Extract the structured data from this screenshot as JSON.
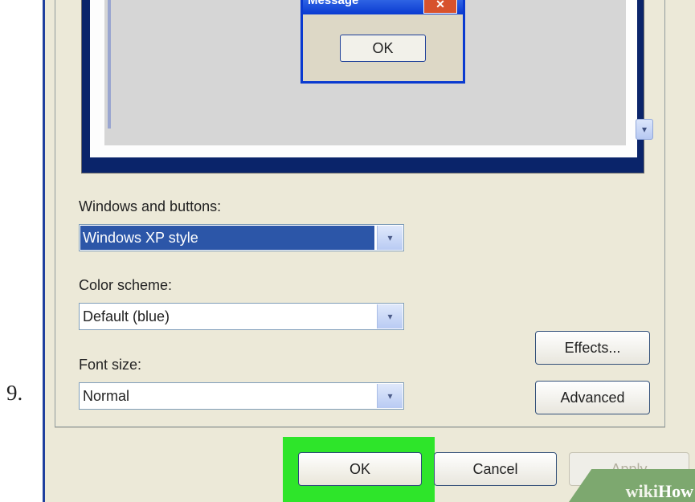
{
  "step": {
    "number": "9."
  },
  "preview": {
    "message_title": "Message",
    "close_glyph": "✕",
    "ok_label": "OK",
    "scroll_glyph": "▾"
  },
  "form": {
    "windows_buttons": {
      "label": "Windows and buttons:",
      "value": "Windows XP style"
    },
    "color_scheme": {
      "label": "Color scheme:",
      "value": "Default (blue)"
    },
    "font_size": {
      "label": "Font size:",
      "value": "Normal"
    },
    "dropdown_glyph": "▾"
  },
  "buttons": {
    "effects": "Effects...",
    "advanced": "Advanced",
    "ok": "OK",
    "cancel": "Cancel",
    "apply": "Apply"
  },
  "watermark": {
    "wiki": "wiki",
    "how": "How"
  },
  "colors": {
    "selection": "#2c56a8",
    "highlight": "#2ee52a",
    "xp_blue": "#0a3ad0",
    "dialog_bg": "#ece9d8"
  },
  "icons": {
    "scroll": "scroll-down-arrow-icon",
    "dropdown": "chevron-down-icon",
    "close": "close-icon"
  }
}
